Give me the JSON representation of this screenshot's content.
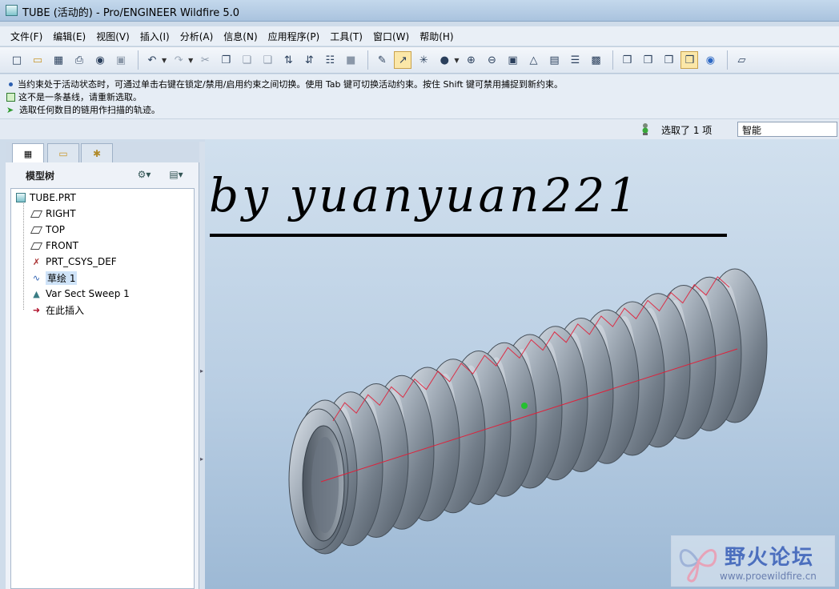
{
  "window": {
    "title": "TUBE (活动的) - Pro/ENGINEER Wildfire 5.0"
  },
  "menu": [
    "文件(F)",
    "编辑(E)",
    "视图(V)",
    "插入(I)",
    "分析(A)",
    "信息(N)",
    "应用程序(P)",
    "工具(T)",
    "窗口(W)",
    "帮助(H)"
  ],
  "toolbar_icons": [
    "new-file",
    "open-folder",
    "save",
    "print",
    "print-preview",
    "erase",
    "undo",
    "redo",
    "cut",
    "copy",
    "paste",
    "paste-special",
    "regenerate",
    "regenerate-manager",
    "find",
    "select-box",
    "repaint",
    "orient",
    "spin-center",
    "shade",
    "zoom-in",
    "zoom-out",
    "refit",
    "view-manager",
    "saved-views",
    "layers",
    "appearance",
    "wireframe",
    "hidden-line",
    "no-hidden",
    "shading",
    "model-tree-display",
    "datum-planes"
  ],
  "messages": [
    "当约束处于活动状态时，可通过单击右键在锁定/禁用/启用约束之间切换。使用 Tab 键可切换活动约束。按住 Shift 键可禁用捕捉到新约束。",
    "这不是一条基线，请重新选取。",
    "选取任何数目的链用作扫描的轨迹。"
  ],
  "selection": {
    "status": "选取了 1 项",
    "filter": "智能"
  },
  "model_tree": {
    "title": "模型树",
    "items": [
      {
        "label": "TUBE.PRT",
        "icon": "part-icon"
      },
      {
        "label": "RIGHT",
        "icon": "datum-plane-icon"
      },
      {
        "label": "TOP",
        "icon": "datum-plane-icon"
      },
      {
        "label": "FRONT",
        "icon": "datum-plane-icon"
      },
      {
        "label": "PRT_CSYS_DEF",
        "icon": "csys-icon"
      },
      {
        "label": "草绘 1",
        "icon": "sketch-icon",
        "selected": true
      },
      {
        "label": "Var Sect Sweep 1",
        "icon": "sweep-icon"
      },
      {
        "label": "在此插入",
        "icon": "insert-here-arrow-icon"
      }
    ]
  },
  "graphics": {
    "signature": "by yuanyuan221",
    "logo": {
      "text": "野火论坛",
      "url": "www.proewildfire.cn"
    }
  },
  "colors": {
    "accent": "#4c6fbe",
    "highlight": "#cfe3f8",
    "trajectory": "#e0203a"
  }
}
